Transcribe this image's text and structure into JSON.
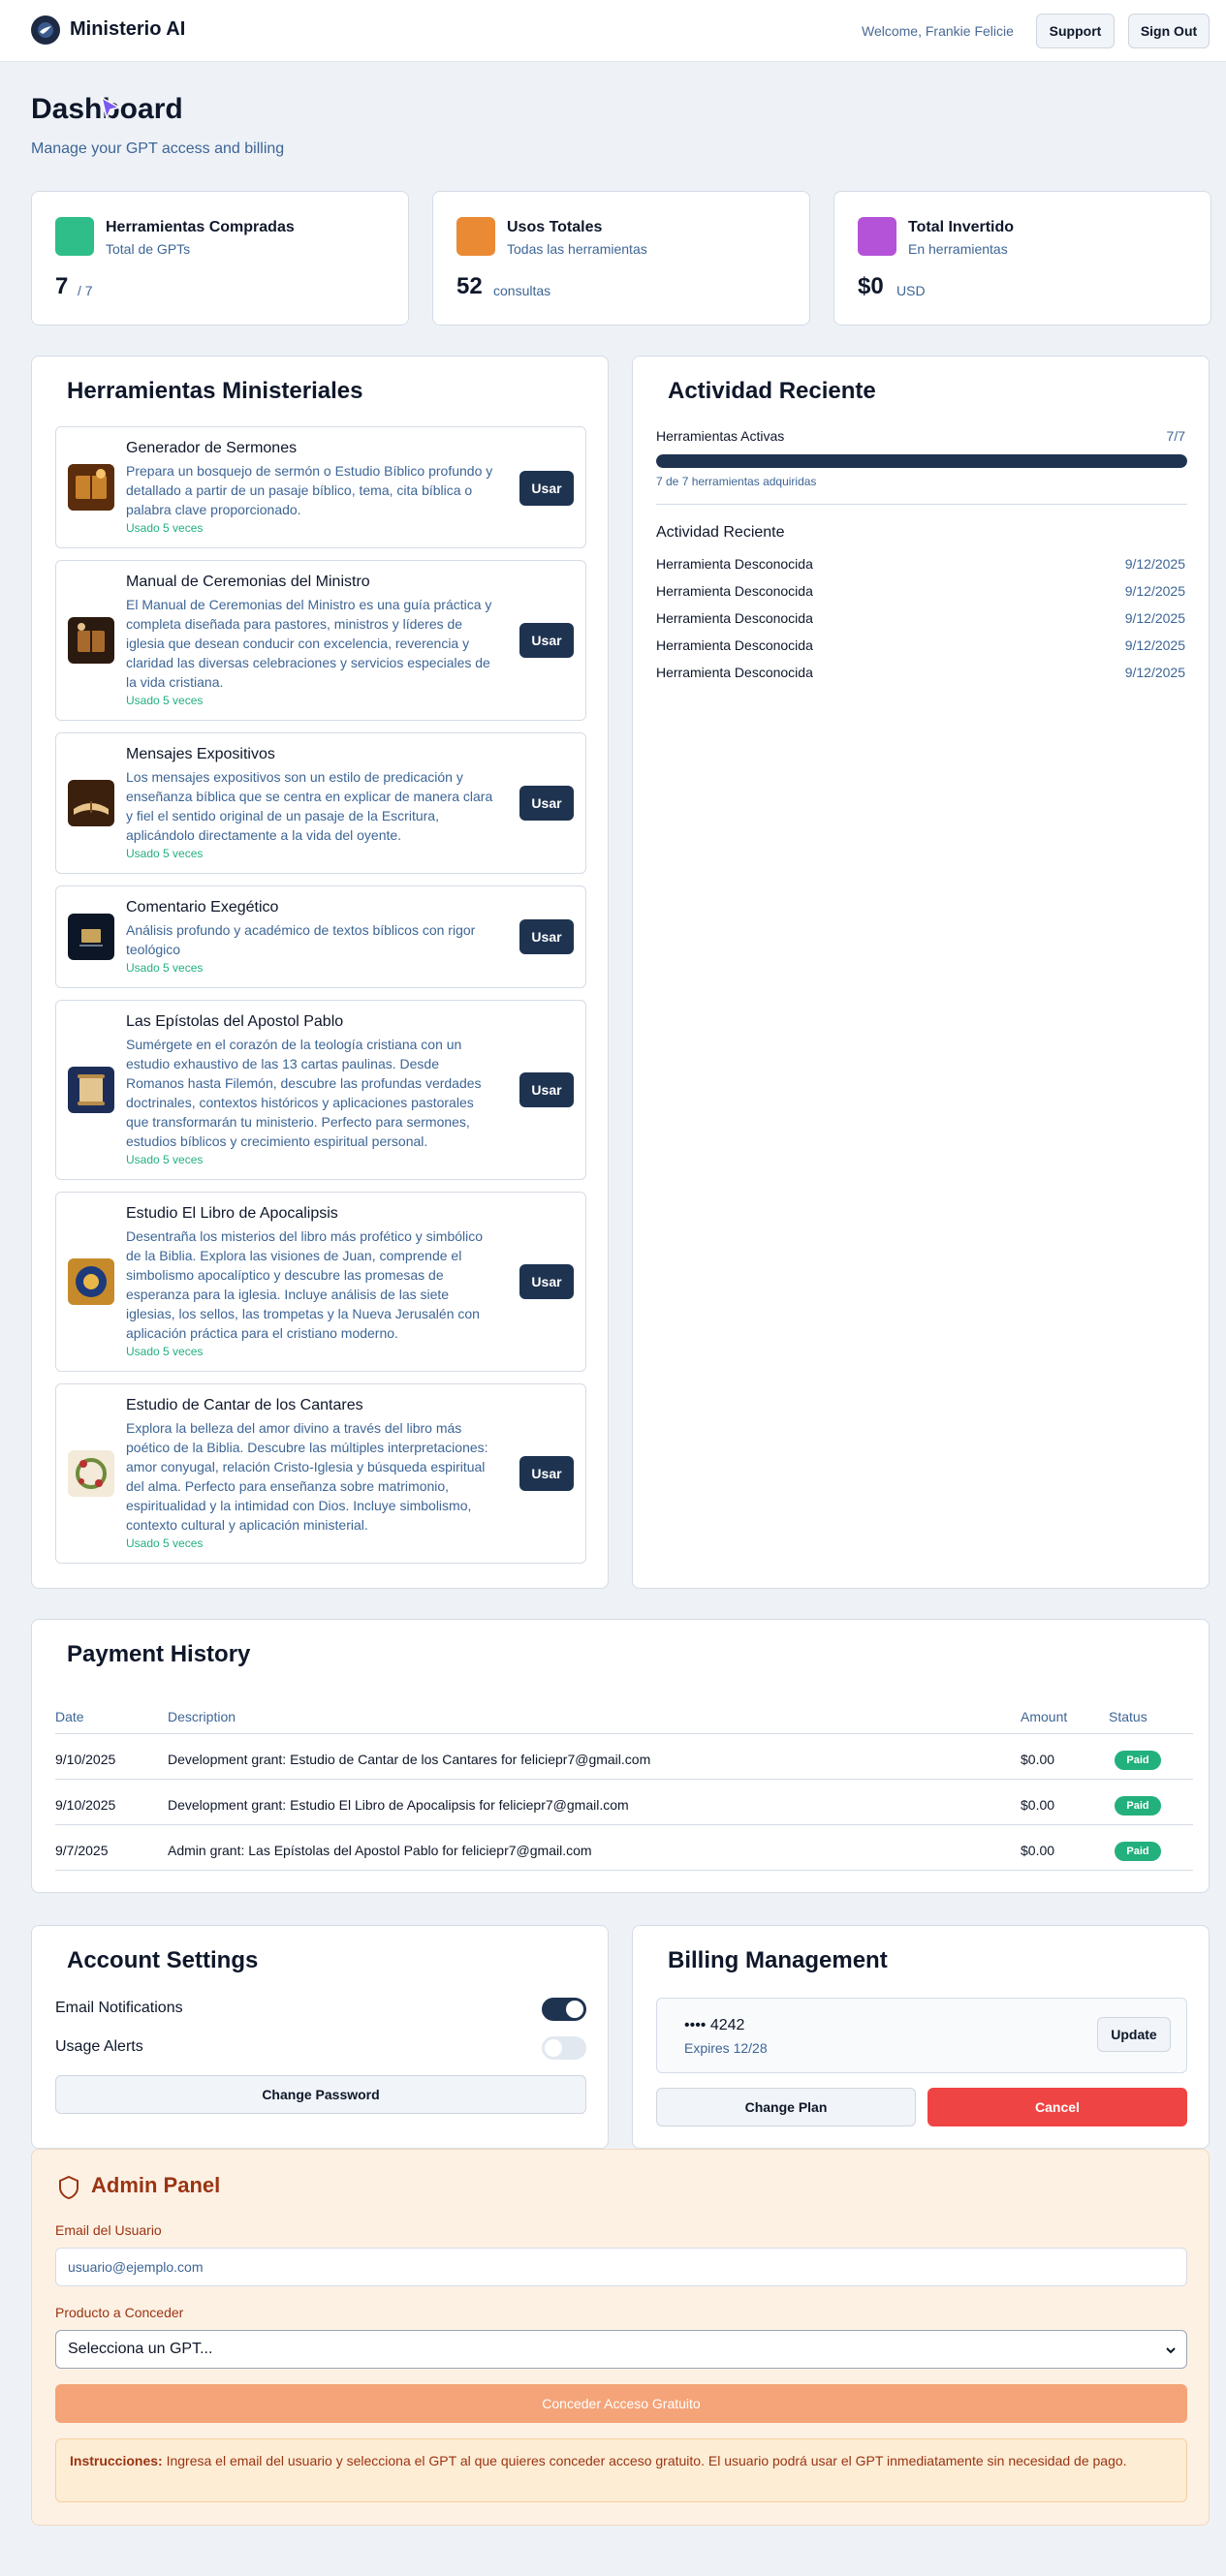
{
  "header": {
    "app_name": "Ministerio AI",
    "welcome": "Welcome, Frankie Felicie",
    "support_label": "Support",
    "signout_label": "Sign Out"
  },
  "page": {
    "title": "Dashboard",
    "subtitle": "Manage your GPT access and billing"
  },
  "stats": [
    {
      "title": "Herramientas Compradas",
      "subtitle": "Total de GPTs",
      "value": "7",
      "unit": "/ 7",
      "color": "#2fbd8a"
    },
    {
      "title": "Usos Totales",
      "subtitle": "Todas las herramientas",
      "value": "52",
      "unit": "consultas",
      "color": "#ea8a34"
    },
    {
      "title": "Total Invertido",
      "subtitle": "En herramientas",
      "value": "$0",
      "unit": "USD",
      "color": "#b453d8"
    }
  ],
  "tools": {
    "title": "Herramientas Ministeriales",
    "button_label": "Usar",
    "items": [
      {
        "name": "Generador de Sermones",
        "desc_lines": [
          "Prepara un bosquejo de sermón o Estudio Bíblico profundo y",
          "detallado a partir de un pasaje bíblico, tema, cita bíblica o",
          "palabra clave proporcionado."
        ],
        "used": "Usado 5 veces",
        "icon": "sermon-book-icon"
      },
      {
        "name": "Manual de Ceremonias del Ministro",
        "desc_lines": [
          "El Manual de Ceremonias del Ministro es una guía práctica y",
          "completa diseñada para pastores, ministros y líderes de",
          "iglesia que desean conducir con excelencia, reverencia y",
          "claridad las diversas celebraciones y servicios especiales de",
          "la vida cristiana."
        ],
        "used": "Usado 5 veces",
        "icon": "ceremony-book-icon"
      },
      {
        "name": "Mensajes Expositivos",
        "desc_lines": [
          "Los mensajes expositivos son un estilo de predicación y",
          "enseñanza bíblica que se centra en explicar de manera clara",
          "y fiel el sentido original de un pasaje de la Escritura,",
          "aplicándolo directamente a la vida del oyente."
        ],
        "used": "Usado 5 veces",
        "icon": "open-bible-icon"
      },
      {
        "name": "Comentario Exegético",
        "desc_lines": [
          "Análisis profundo y académico de textos bíblicos con rigor",
          "teológico"
        ],
        "used": "Usado 5 veces",
        "icon": "commentary-icon"
      },
      {
        "name": "Las Epístolas del Apostol Pablo",
        "desc_lines": [
          "Sumérgete en el corazón de la teología cristiana con un",
          "estudio exhaustivo de las 13 cartas paulinas. Desde",
          "Romanos hasta Filemón, descubre las profundas verdades",
          "doctrinales, contextos históricos y aplicaciones pastorales",
          "que transformarán tu ministerio. Perfecto para sermones,",
          "estudios bíblicos y crecimiento espiritual personal."
        ],
        "used": "Usado 5 veces",
        "icon": "scroll-icon"
      },
      {
        "name": "Estudio El Libro de Apocalipsis",
        "desc_lines": [
          "Desentraña los misterios del libro más profético y simbólico",
          "de la Biblia. Explora las visiones de Juan, comprende el",
          "simbolismo apocalíptico y descubre las promesas de",
          "esperanza para la iglesia. Incluye análisis de las siete",
          "iglesias, los sellos, las trompetas y la Nueva Jerusalén con",
          "aplicación práctica para el cristiano moderno."
        ],
        "used": "Usado 5 veces",
        "icon": "revelation-emblem-icon"
      },
      {
        "name": "Estudio de Cantar de los Cantares",
        "desc_lines": [
          "Explora la belleza del amor divino a través del libro más",
          "poético de la Biblia. Descubre las múltiples interpretaciones:",
          "amor conyugal, relación Cristo-Iglesia y búsqueda espiritual",
          "del alma. Perfecto para enseñanza sobre matrimonio,",
          "espiritualidad y la intimidad con Dios. Incluye simbolismo,",
          "contexto cultural y aplicación ministerial."
        ],
        "used": "Usado 5 veces",
        "icon": "rose-wreath-icon"
      }
    ]
  },
  "activity": {
    "title": "Actividad Reciente",
    "active_label": "Herramientas Activas",
    "active_value": "7/7",
    "progress_fraction": 1.0,
    "progress_note": "7 de 7 herramientas adquiridas",
    "recent_title": "Actividad Reciente",
    "items": [
      {
        "label": "Herramienta Desconocida",
        "date": "9/12/2025"
      },
      {
        "label": "Herramienta Desconocida",
        "date": "9/12/2025"
      },
      {
        "label": "Herramienta Desconocida",
        "date": "9/12/2025"
      },
      {
        "label": "Herramienta Desconocida",
        "date": "9/12/2025"
      },
      {
        "label": "Herramienta Desconocida",
        "date": "9/12/2025"
      }
    ]
  },
  "payments": {
    "title": "Payment History",
    "columns": [
      "Date",
      "Description",
      "Amount",
      "Status"
    ],
    "rows": [
      {
        "date": "9/10/2025",
        "description": "Development grant: Estudio de Cantar de los Cantares for feliciepr7@gmail.com",
        "amount": "$0.00",
        "status": "Paid"
      },
      {
        "date": "9/10/2025",
        "description": "Development grant: Estudio El Libro de Apocalipsis for feliciepr7@gmail.com",
        "amount": "$0.00",
        "status": "Paid"
      },
      {
        "date": "9/7/2025",
        "description": "Admin grant: Las Epístolas del Apostol Pablo for feliciepr7@gmail.com",
        "amount": "$0.00",
        "status": "Paid"
      }
    ]
  },
  "account": {
    "title": "Account Settings",
    "email_notifications": "Email Notifications",
    "email_notifications_on": true,
    "usage_alerts": "Usage Alerts",
    "usage_alerts_on": false,
    "change_password": "Change Password"
  },
  "billing": {
    "title": "Billing Management",
    "card_number": "•••• 4242",
    "expires": "Expires 12/28",
    "update_label": "Update",
    "change_plan_label": "Change Plan",
    "cancel_label": "Cancel"
  },
  "admin": {
    "title": "Admin Panel",
    "email_label": "Email del Usuario",
    "email_placeholder": "usuario@ejemplo.com",
    "product_label": "Producto a Conceder",
    "product_select": "Selecciona un GPT...",
    "grant_button": "Conceder Acceso Gratuito",
    "instructions_bold": "Instrucciones:",
    "instructions_text": " Ingresa el email del usuario y selecciona el GPT al que quieres conceder acceso gratuito. El usuario podrá usar el GPT inmediatamente sin necesidad de pago."
  }
}
